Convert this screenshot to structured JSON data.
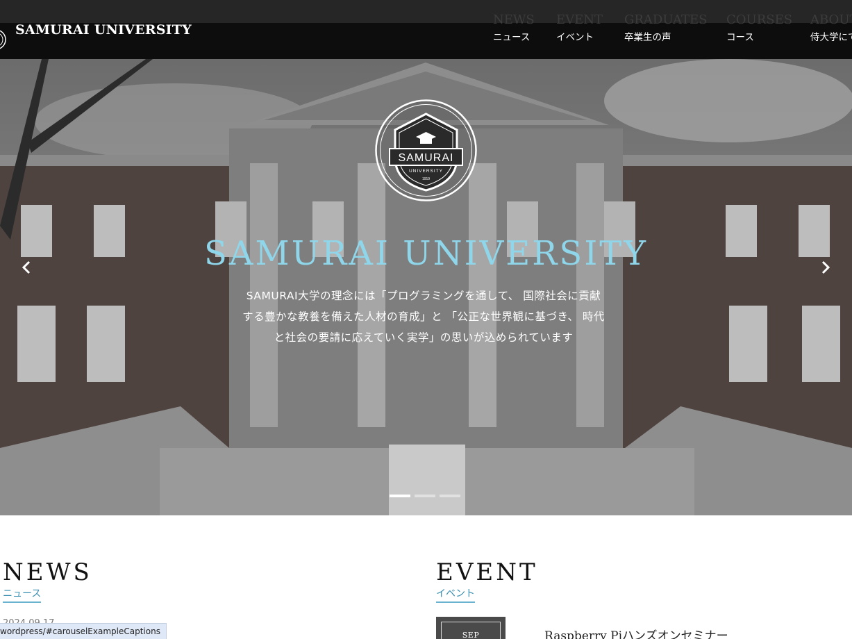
{
  "header": {
    "brand_name": "SAMURAI UNIVERSITY",
    "nav": [
      {
        "en": "NEWS",
        "jp": "ニュース"
      },
      {
        "en": "EVENT",
        "jp": "イベント"
      },
      {
        "en": "GRADUATES",
        "jp": "卒業生の声"
      },
      {
        "en": "COURSES",
        "jp": "コース"
      },
      {
        "en": "ABOUT",
        "jp": "侍大学にて"
      }
    ]
  },
  "hero": {
    "emblem_text": "SAMURAI",
    "emblem_sub": "UNIVERSITY",
    "emblem_year": "1919",
    "title": "SAMURAI UNIVERSITY",
    "caption_line1": "SAMURAI大学の理念には「プログラミングを通して、 国際社会に貢献",
    "caption_line2": "する豊かな教養を備えた人材の育成」と 「公正な世界観に基づき、 時代",
    "caption_line3": "と社会の要請に応えていく実学」の思いが込められています",
    "slides": 3,
    "active_slide": 1
  },
  "news": {
    "title": "NEWS",
    "subtitle": "ニュース",
    "first_date": "2024.09.17"
  },
  "event": {
    "title": "EVENT",
    "subtitle": "イベント",
    "first_month": "SEP",
    "first_title": "Raspberry Piハンズオンセミナー"
  },
  "status_bar": {
    "url": "wordpress/#carouselExampleCaptions"
  },
  "colors": {
    "header_bg": "#0d0d0d",
    "accent_cyan": "#8fd6ea",
    "subtitle_blue": "#3a8fb0"
  }
}
